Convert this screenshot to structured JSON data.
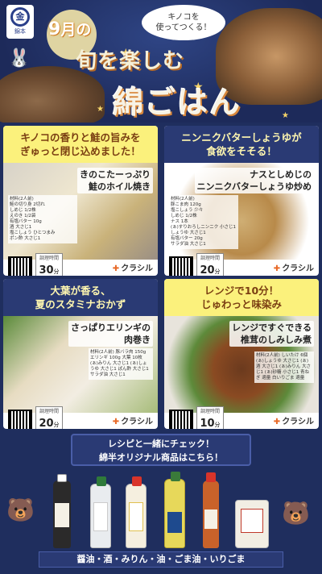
{
  "header": {
    "logo_text": "金",
    "logo_sub": "錦本",
    "month_num": "9",
    "month_suffix": "月の",
    "bubble": "キノコを\n使ってつくる！",
    "title_line1": "旬を楽しむ",
    "title_line2": "綿ごはん"
  },
  "cards": [
    {
      "headline": "キノコの香りと鮭の旨みを\nぎゅっと閉じ込めました！",
      "dish": "きのこたーっぷり\n鮭のホイル焼き",
      "ingredients": "材料(2人前)\n鮭の切り身 2切れ\nしめじ 1/2株\nえのき 1/2袋\n有塩バター 10g\n酒 大さじ1\n塩こしょう ひとつまみ\nポン酢 大さじ1",
      "time_label": "調理時間",
      "time_value": "30",
      "time_unit": "分",
      "brand": "クラシル"
    },
    {
      "headline": "ニンニクバターしょうゆが\n食欲をそそる！",
      "dish": "ナスとしめじの\nニンニクバターしょうゆ炒め",
      "ingredients": "材料(2人前)\n豚こま肉 120g\n塩こしょう 少々\nしめじ 1/2株\nナス 1本\n(ぁ)すりおろしニンニク 小さじ1\nしょうゆ 大さじ1\n有塩バター 20g\nサラダ油 大さじ1",
      "time_label": "調理時間",
      "time_value": "20",
      "time_unit": "分",
      "brand": "クラシル"
    },
    {
      "headline": "大葉が香る、\n夏のスタミナおかず",
      "dish": "さっぱりエリンギの\n肉巻き",
      "ingredients": "材料(2人前)\n豚バラ肉 150g\nエリンギ 100g\n大葉 10枚\n(ぁ)みりん 大さじ1\n(ぁ)しょうゆ 大さじ1\nぽん酢 大さじ1\nサラダ油 大さじ1",
      "time_label": "調理時間",
      "time_value": "20",
      "time_unit": "分",
      "brand": "クラシル"
    },
    {
      "headline": "レンジで10分！\nじゅわっと味染み",
      "dish": "レンジですぐできる\n椎茸のしみしみ煮",
      "ingredients": "材料(2人前)\nしいたけ 6個\n(ぁ)しょうゆ 大さじ1\n(ぁ)酒 大さじ1\n(ぁ)みりん 大さじ1\n(ぁ)砂糖 小さじ1\n青ねぎ 適量\n白いりごま 適量",
      "time_label": "調理時間",
      "time_value": "10",
      "time_unit": "分",
      "brand": "クラシル"
    }
  ],
  "promo": {
    "line1": "レシピと一緒にチェック！",
    "line2": "綿半オリジナル商品はこちら！"
  },
  "footer": {
    "products_label": "醤油・酒・みりん・油・ごま油・いりごま"
  },
  "colors": {
    "navy": "#2a3a74",
    "yellow": "#fbf17c",
    "brand_orange": "#e86a28"
  }
}
